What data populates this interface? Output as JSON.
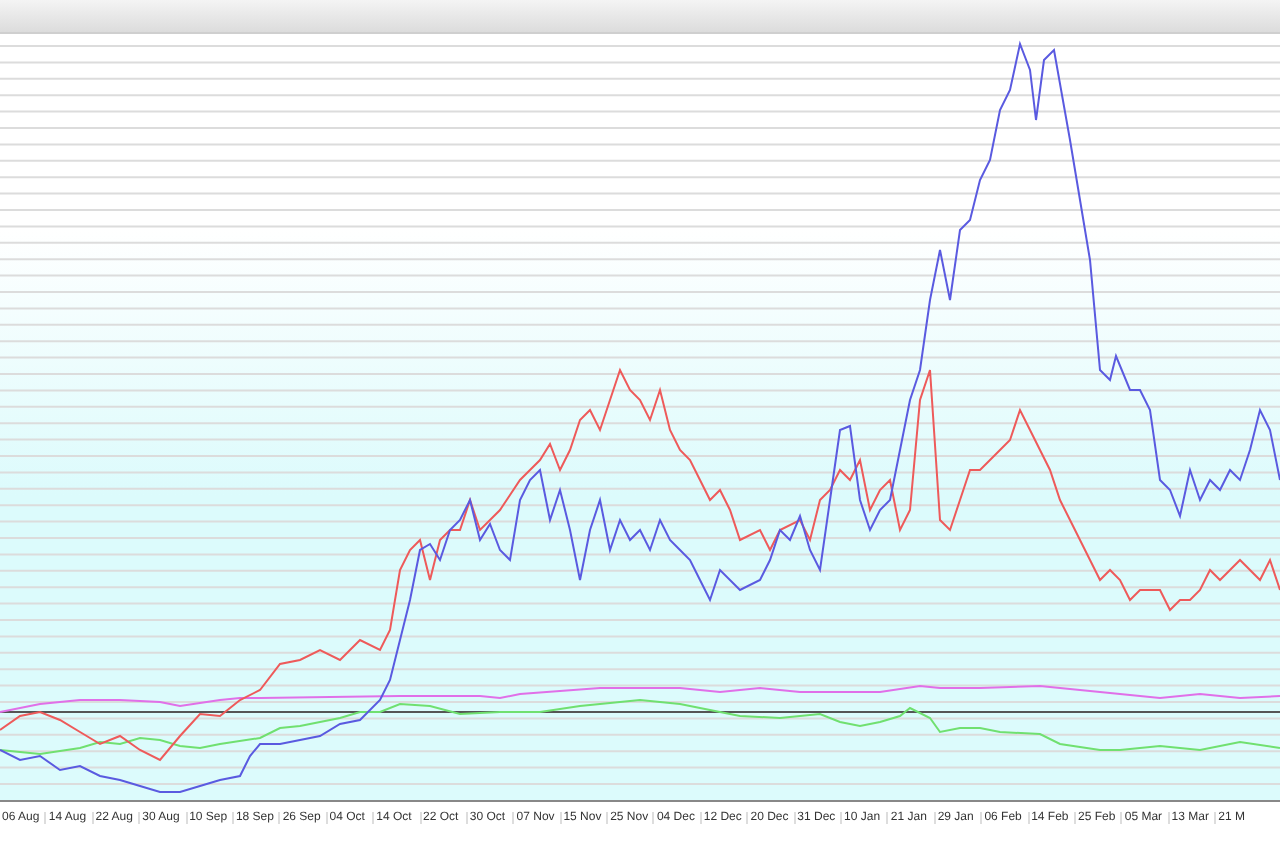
{
  "x_axis": {
    "labels": [
      "06 Aug",
      "14 Aug",
      "22 Aug",
      "30 Aug",
      "10 Sep",
      "18 Sep",
      "26 Sep",
      "04 Oct",
      "14 Oct",
      "22 Oct",
      "30 Oct",
      "07 Nov",
      "15 Nov",
      "25 Nov",
      "04 Dec",
      "12 Dec",
      "20 Dec",
      "31 Dec",
      "10 Jan",
      "21 Jan",
      "29 Jan",
      "06 Feb",
      "14 Feb",
      "25 Feb",
      "05 Mar",
      "13 Mar",
      "21 M"
    ]
  }
}
